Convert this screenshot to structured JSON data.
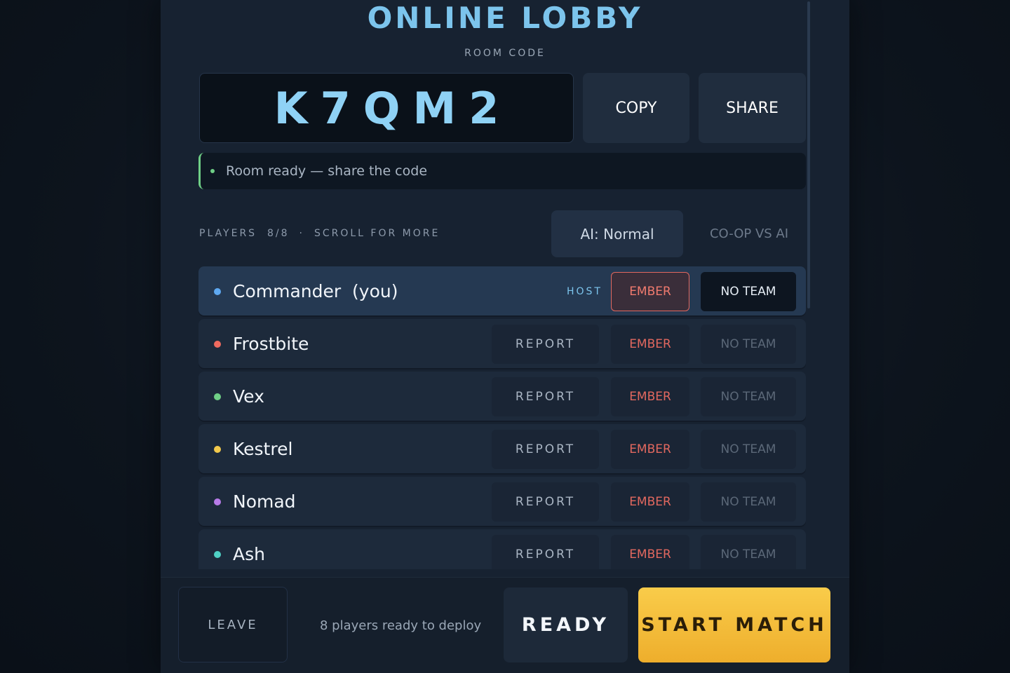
{
  "header": {
    "title": "ONLINE LOBBY",
    "room_code_label": "ROOM CODE",
    "room_code": "K7QM2",
    "copy_label": "COPY",
    "share_label": "SHARE"
  },
  "status": {
    "text": "Room ready — share the code",
    "color": "#6fcf86"
  },
  "players_header": {
    "count_label": "PLAYERS  8/8",
    "separator": "·",
    "scroll_hint": "SCROLL FOR MORE",
    "ai_label": "AI: Normal",
    "mode_label": "CO-OP VS AI"
  },
  "players": [
    {
      "name": "Commander  (you)",
      "color": "#5ea9f2",
      "host": true,
      "host_label": "HOST",
      "faction": "EMBER",
      "team": "NO TEAM"
    },
    {
      "name": "Frostbite",
      "color": "#ef6a5f",
      "report_label": "REPORT",
      "faction": "EMBER",
      "team": "NO TEAM"
    },
    {
      "name": "Vex",
      "color": "#6fcf86",
      "report_label": "REPORT",
      "faction": "EMBER",
      "team": "NO TEAM"
    },
    {
      "name": "Kestrel",
      "color": "#f2c94c",
      "report_label": "REPORT",
      "faction": "EMBER",
      "team": "NO TEAM"
    },
    {
      "name": "Nomad",
      "color": "#b77be8",
      "report_label": "REPORT",
      "faction": "EMBER",
      "team": "NO TEAM"
    },
    {
      "name": "Ash",
      "color": "#4fd1c5",
      "report_label": "REPORT",
      "faction": "EMBER",
      "team": "NO TEAM"
    }
  ],
  "footer": {
    "leave_label": "LEAVE",
    "ready_status": "8 players ready to deploy",
    "ready_label": "READY",
    "start_label": "START MATCH"
  },
  "colors": {
    "accent": "#7cc4ec",
    "ember": "#e2685f",
    "start": "#f5bd3a"
  }
}
